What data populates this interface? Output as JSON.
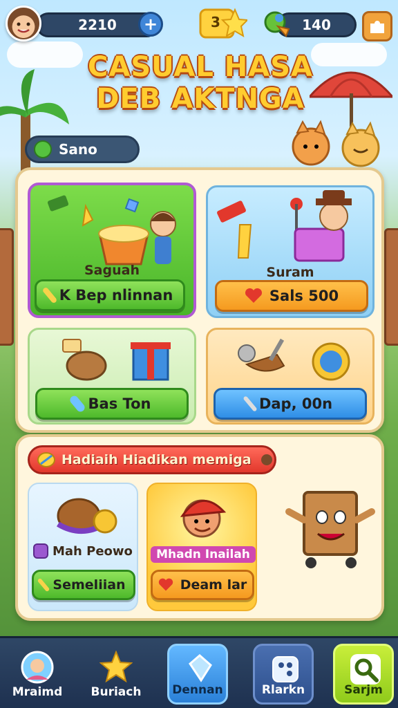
{
  "hud": {
    "coins": "2210",
    "plus_label": "+",
    "level": "3",
    "gems": "140"
  },
  "title": {
    "line1": "CASUAL HASA",
    "line2": "DEB AKTNGA"
  },
  "profile_chip": {
    "label": "Sano"
  },
  "cards": [
    {
      "label": "Saguah",
      "button": "K Bep nlinnan"
    },
    {
      "label": "Suram",
      "button": "Sals 500"
    },
    {
      "label": "",
      "button": "Bas Ton"
    },
    {
      "label": "",
      "button": "Dap, 00n"
    }
  ],
  "rewards": {
    "banner": "Hadiaih Hiadikan memiga",
    "items": [
      {
        "label": "Mah Peowo",
        "button": "Semeliian"
      },
      {
        "label": "Mhadn Inailah",
        "button": "Deam lar"
      }
    ]
  },
  "nav": [
    {
      "label": "Mraimd",
      "icon": "profile-icon"
    },
    {
      "label": "Buriach",
      "icon": "star-icon"
    },
    {
      "label": "Dennan",
      "icon": "gem-icon"
    },
    {
      "label": "Rlarkn",
      "icon": "dice-icon"
    },
    {
      "label": "Sarjm",
      "icon": "search-icon"
    }
  ],
  "colors": {
    "green": "#4eb92b",
    "orange": "#f59a1f",
    "blue": "#2f8ee6",
    "red_banner": "#e2382c",
    "nav_bg": "#2f4766"
  }
}
